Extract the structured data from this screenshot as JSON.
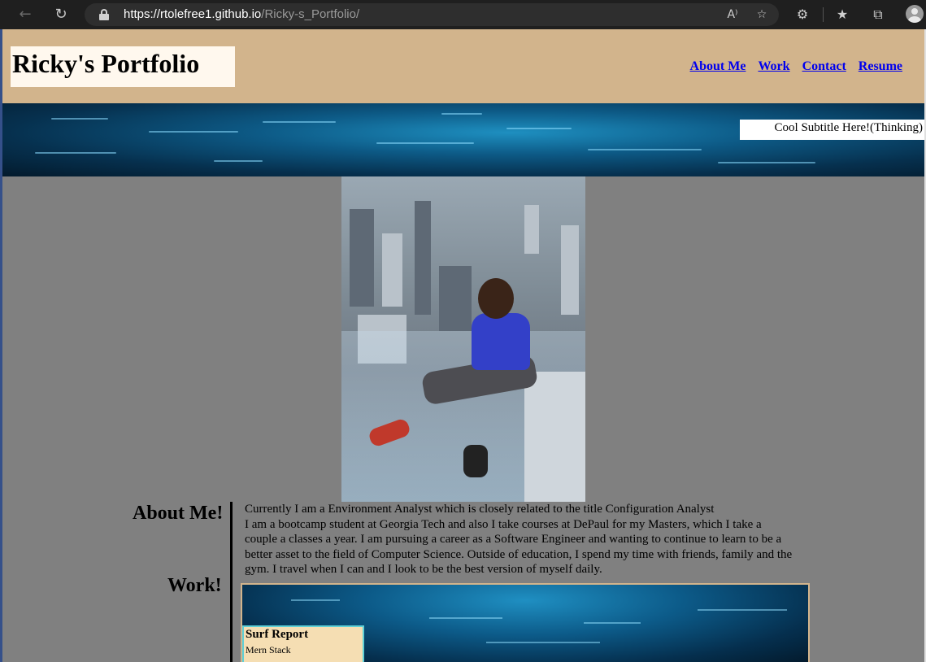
{
  "browser": {
    "url_host": "https://rtolefree1.github.io",
    "url_path": "/Ricky-s_Portfolio/",
    "icons": {
      "back": "back-arrow-icon",
      "refresh": "refresh-icon",
      "lock": "lock-icon",
      "read_aloud": "read-aloud-icon",
      "favorite": "add-favorite-icon",
      "extensions": "extensions-icon",
      "favorites": "favorites-icon",
      "collections": "collections-icon",
      "profile": "profile-avatar-icon"
    }
  },
  "header": {
    "title": "Ricky's Portfolio",
    "nav": [
      "About Me",
      "Work",
      "Contact",
      "Resume"
    ]
  },
  "banner": {
    "subtitle": "Cool Subtitle Here!(Thinking)"
  },
  "about": {
    "heading": "About Me!",
    "line1": "Currently I am a Environment Analyst which is closely related to the title Configuration Analyst",
    "paragraph": "I am a bootcamp student at Georgia Tech and also I take courses at DePaul for my Masters, which I take a couple a classes a year. I am pursuing a career as a Software Engineer and wanting to continue to learn to be a better asset to the field of Computer Science. Outside of education, I spend my time with friends, family and the gym. I travel when I can and I look to be the best version of myself daily."
  },
  "work": {
    "heading": "Work!",
    "projects": [
      {
        "title": "Surf Report",
        "subtitle": "Mern Stack"
      }
    ]
  },
  "colors": {
    "header_bg": "#d2b48c",
    "page_bg": "#808080",
    "link": "#0000ee",
    "card_bg": "#f5deb3",
    "card_border": "#5fd0d6"
  }
}
